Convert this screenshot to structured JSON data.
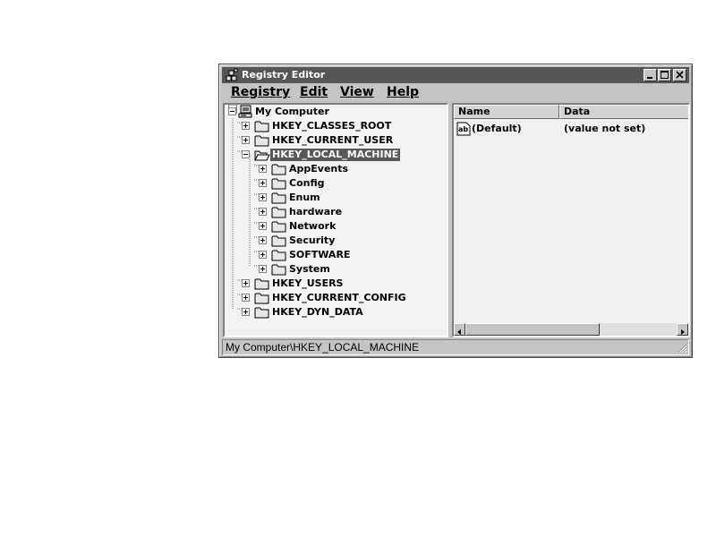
{
  "window": {
    "title": "Registry Editor",
    "icon": "regedit-icon",
    "controls": [
      "minimize",
      "maximize",
      "close"
    ]
  },
  "menu": {
    "items": [
      {
        "label": "Registry"
      },
      {
        "label": "Edit"
      },
      {
        "label": "View"
      },
      {
        "label": "Help"
      }
    ]
  },
  "tree": {
    "root": {
      "label": "My Computer",
      "icon": "computer-icon",
      "expanded": true
    },
    "hives": [
      {
        "label": "HKEY_CLASSES_ROOT",
        "expanded": false
      },
      {
        "label": "HKEY_CURRENT_USER",
        "expanded": false
      },
      {
        "label": "HKEY_LOCAL_MACHINE",
        "expanded": true,
        "selected": true
      },
      {
        "label": "HKEY_USERS",
        "expanded": false
      },
      {
        "label": "HKEY_CURRENT_CONFIG",
        "expanded": false
      },
      {
        "label": "HKEY_DYN_DATA",
        "expanded": false
      }
    ],
    "subkeys": [
      {
        "label": "AppEvents"
      },
      {
        "label": "Config"
      },
      {
        "label": "Enum"
      },
      {
        "label": "hardware"
      },
      {
        "label": "Network"
      },
      {
        "label": "Security"
      },
      {
        "label": "SOFTWARE"
      },
      {
        "label": "System"
      }
    ]
  },
  "list": {
    "columns": {
      "name": "Name",
      "data": "Data"
    },
    "rows": [
      {
        "name": "(Default)",
        "data": "(value not set)",
        "icon": "string-value-icon"
      }
    ]
  },
  "status": {
    "path": "My Computer\\HKEY_LOCAL_MACHINE"
  },
  "colors": {
    "title_bar": "#565656",
    "window_face": "#c4c4c4",
    "selection": "#585858",
    "pane_background": "#f2f2f2"
  }
}
